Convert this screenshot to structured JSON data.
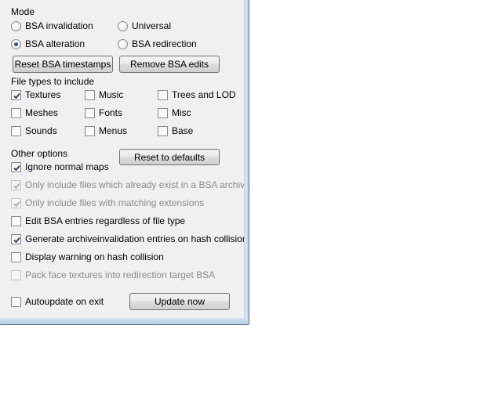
{
  "mode": {
    "label": "Mode",
    "options": [
      {
        "label": "BSA invalidation",
        "checked": false
      },
      {
        "label": "Universal",
        "checked": false
      },
      {
        "label": "BSA alteration",
        "checked": true
      },
      {
        "label": "BSA redirection",
        "checked": false
      }
    ]
  },
  "buttons": {
    "reset_timestamps": "Reset BSA timestamps",
    "remove_edits": "Remove BSA edits",
    "reset_defaults": "Reset to defaults",
    "update_now": "Update now"
  },
  "file_types": {
    "label": "File types to include",
    "items": [
      {
        "label": "Textures",
        "checked": true
      },
      {
        "label": "Music",
        "checked": false
      },
      {
        "label": "Trees and LOD",
        "checked": false
      },
      {
        "label": "Meshes",
        "checked": false
      },
      {
        "label": "Fonts",
        "checked": false
      },
      {
        "label": "Misc",
        "checked": false
      },
      {
        "label": "Sounds",
        "checked": false
      },
      {
        "label": "Menus",
        "checked": false
      },
      {
        "label": "Base",
        "checked": false
      }
    ]
  },
  "other": {
    "label": "Other options",
    "items": [
      {
        "label": "Ignore normal maps",
        "checked": true,
        "enabled": true
      },
      {
        "label": "Only include files which already exist in a BSA archive",
        "checked": true,
        "enabled": false
      },
      {
        "label": "Only include files with matching extensions",
        "checked": true,
        "enabled": false
      },
      {
        "label": "Edit BSA entries regardless of file type",
        "checked": false,
        "enabled": true
      },
      {
        "label": "Generate archiveinvalidation entries on hash collision",
        "checked": true,
        "enabled": true
      },
      {
        "label": "Display warning on hash collision",
        "checked": false,
        "enabled": true
      },
      {
        "label": "Pack face textures into redirection target BSA",
        "checked": false,
        "enabled": false
      }
    ]
  },
  "autoupdate": {
    "label": "Autoupdate on exit",
    "checked": false
  },
  "colors": {
    "window_bg": "#f0f0f0",
    "frame": "#c3d5ea",
    "disabled_text": "#8a8a8a"
  }
}
